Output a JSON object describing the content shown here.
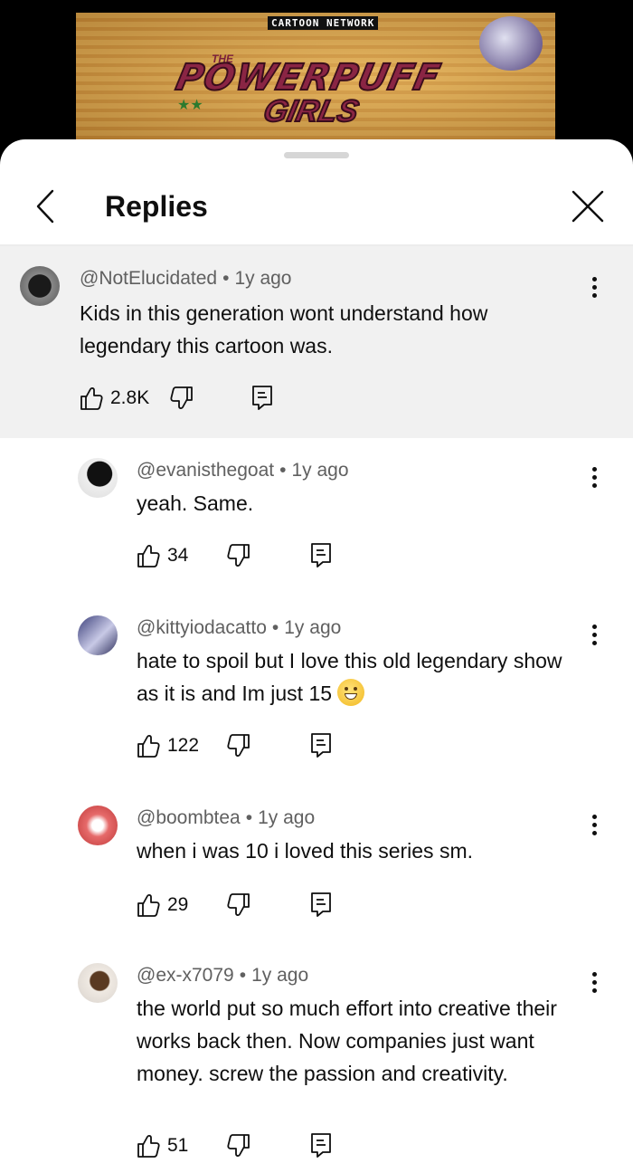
{
  "video": {
    "network_logo": "CARTOON NETWORK",
    "show_title_small": "THE",
    "show_title_line1": "POWERPUFF",
    "show_title_line2": "GIRLS"
  },
  "header": {
    "title": "Replies",
    "back_icon": "chevron-left-icon",
    "close_icon": "close-icon"
  },
  "parent_comment": {
    "author": "@NotElucidated",
    "time": "1y ago",
    "text": "Kids in this generation wont understand how legendary this cartoon was.",
    "likes": "2.8K"
  },
  "replies": [
    {
      "author": "@evanisthegoat",
      "time": "1y ago",
      "text": "yeah. Same.",
      "likes": "34"
    },
    {
      "author": "@kittyiodacatto",
      "time": "1y ago",
      "text": "hate to spoil but I love this old legendary show as it is and Im just 15",
      "emoji": "grinning-face",
      "likes": "122"
    },
    {
      "author": "@boombtea",
      "time": "1y ago",
      "text": "when i was 10 i loved this series sm.",
      "likes": "29"
    },
    {
      "author": "@ex-x7079",
      "time": "1y ago",
      "text": "the world put so much effort into creative their works back then. Now companies just want money. screw the passion and creativity.",
      "likes": "51"
    }
  ],
  "colors": {
    "highlight_bg": "#f1f1f1",
    "meta_text": "#606060",
    "text": "#0f0f0f"
  }
}
